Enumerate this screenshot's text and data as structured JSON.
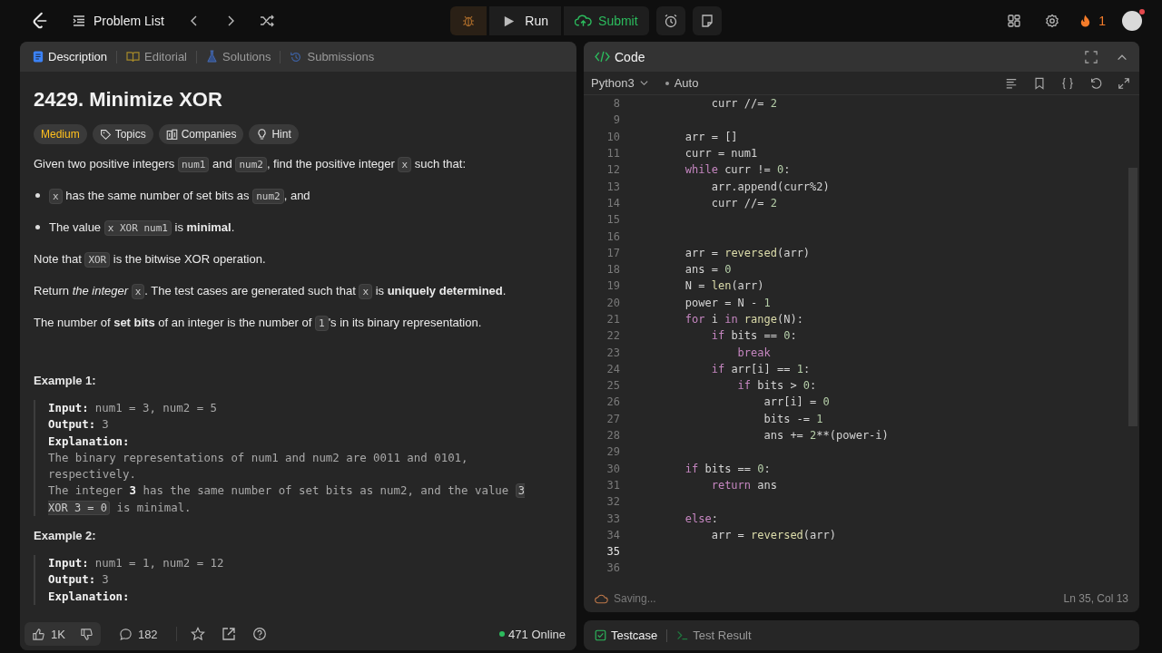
{
  "topbar": {
    "problem_list": "Problem List",
    "run": "Run",
    "submit": "Submit",
    "streak": "1"
  },
  "description_tabs": [
    {
      "label": "Description",
      "kind": "description",
      "selected": true
    },
    {
      "label": "Editorial",
      "kind": "editorial",
      "selected": false
    },
    {
      "label": "Solutions",
      "kind": "solutions",
      "selected": false
    },
    {
      "label": "Submissions",
      "kind": "submissions",
      "selected": false
    }
  ],
  "problem": {
    "title": "2429. Minimize XOR",
    "difficulty": "Medium",
    "tags": [
      {
        "label": "Topics",
        "kind": "topics"
      },
      {
        "label": "Companies",
        "kind": "companies"
      },
      {
        "label": "Hint",
        "kind": "hint"
      }
    ],
    "paragraphs": [
      {
        "kind": "para",
        "segments": [
          {
            "kind": "plain",
            "text": "Given two positive integers "
          },
          {
            "kind": "code",
            "text": "num1"
          },
          {
            "kind": "plain",
            "text": " and "
          },
          {
            "kind": "code",
            "text": "num2"
          },
          {
            "kind": "plain",
            "text": ", find the positive integer "
          },
          {
            "kind": "code",
            "text": "x"
          },
          {
            "kind": "plain",
            "text": " such that:"
          }
        ]
      },
      {
        "kind": "bullet",
        "segments": [
          {
            "kind": "code",
            "text": "x"
          },
          {
            "kind": "plain",
            "text": " has the same number of set bits as "
          },
          {
            "kind": "code",
            "text": "num2"
          },
          {
            "kind": "plain",
            "text": ", and"
          }
        ]
      },
      {
        "kind": "bullet",
        "segments": [
          {
            "kind": "plain",
            "text": "The value "
          },
          {
            "kind": "code",
            "text": "x XOR num1"
          },
          {
            "kind": "plain",
            "text": " is "
          },
          {
            "kind": "bold",
            "text": "minimal"
          },
          {
            "kind": "plain",
            "text": "."
          }
        ]
      },
      {
        "kind": "para",
        "segments": [
          {
            "kind": "plain",
            "text": "Note that "
          },
          {
            "kind": "code",
            "text": "XOR"
          },
          {
            "kind": "plain",
            "text": " is the bitwise XOR operation."
          }
        ]
      },
      {
        "kind": "para",
        "segments": [
          {
            "kind": "plain",
            "text": "Return "
          },
          {
            "kind": "italic",
            "text": "the integer "
          },
          {
            "kind": "code",
            "text": "x"
          },
          {
            "kind": "plain",
            "text": ". The test cases are generated such that "
          },
          {
            "kind": "code",
            "text": "x"
          },
          {
            "kind": "plain",
            "text": " is "
          },
          {
            "kind": "bold",
            "text": "uniquely determined"
          },
          {
            "kind": "plain",
            "text": "."
          }
        ]
      },
      {
        "kind": "para",
        "segments": [
          {
            "kind": "plain",
            "text": "The number of "
          },
          {
            "kind": "bold",
            "text": "set bits"
          },
          {
            "kind": "plain",
            "text": " of an integer is the number of "
          },
          {
            "kind": "code",
            "text": "1"
          },
          {
            "kind": "plain",
            "text": "'s in its binary representation."
          }
        ]
      }
    ],
    "examples": [
      {
        "title": "Example 1:",
        "lines": [
          {
            "label": "Input:",
            "value": "num1 = 3, num2 = 5"
          },
          {
            "label": "Output:",
            "value": "3"
          },
          {
            "label": "Explanation:"
          }
        ],
        "explanation": [
          [
            {
              "kind": "plain",
              "text": "The binary representations of num1 and num2 are 0011 and 0101, respectively."
            }
          ],
          [
            {
              "kind": "plain",
              "text": "The integer "
            },
            {
              "kind": "bold",
              "text": "3"
            },
            {
              "kind": "plain",
              "text": " has the same number of set bits as num2, and the value "
            },
            {
              "kind": "code",
              "text": "3 XOR 3 = 0"
            },
            {
              "kind": "plain",
              "text": " is minimal."
            }
          ]
        ]
      },
      {
        "title": "Example 2:",
        "lines": [
          {
            "label": "Input:",
            "value": "num1 = 1, num2 = 12"
          },
          {
            "label": "Output:",
            "value": "3"
          },
          {
            "label": "Explanation:"
          }
        ]
      }
    ]
  },
  "footer": {
    "likes": "1K",
    "comments": "182",
    "online": "471 Online"
  },
  "code_panel": {
    "title": "Code",
    "language": "Python3",
    "mode": "Auto",
    "status": "Saving...",
    "cursor": "Ln 35, Col 13",
    "lines": [
      {
        "n": "8",
        "current": false,
        "tokens": [
          {
            "kind": "plain",
            "text": "            curr //= "
          },
          {
            "kind": "num",
            "text": "2"
          }
        ]
      },
      {
        "n": "9",
        "current": false
      },
      {
        "n": "10",
        "current": false,
        "tokens": [
          {
            "kind": "plain",
            "text": "        arr = []"
          }
        ]
      },
      {
        "n": "11",
        "current": false,
        "tokens": [
          {
            "kind": "plain",
            "text": "        curr = num1"
          }
        ]
      },
      {
        "n": "12",
        "current": false,
        "tokens": [
          {
            "kind": "kw",
            "text": "        while"
          },
          {
            "kind": "plain",
            "text": " curr != "
          },
          {
            "kind": "num",
            "text": "0"
          },
          {
            "kind": "plain",
            "text": ":"
          }
        ]
      },
      {
        "n": "13",
        "current": false,
        "tokens": [
          {
            "kind": "plain",
            "text": "            arr.append(curr%2)"
          }
        ]
      },
      {
        "n": "14",
        "current": false,
        "tokens": [
          {
            "kind": "plain",
            "text": "            curr //= "
          },
          {
            "kind": "num",
            "text": "2"
          }
        ]
      },
      {
        "n": "15",
        "current": false
      },
      {
        "n": "16",
        "current": false
      },
      {
        "n": "17",
        "current": false,
        "tokens": [
          {
            "kind": "plain",
            "text": "        arr = "
          },
          {
            "kind": "fn",
            "text": "reversed"
          },
          {
            "kind": "plain",
            "text": "(arr)"
          }
        ]
      },
      {
        "n": "18",
        "current": false,
        "tokens": [
          {
            "kind": "plain",
            "text": "        ans = "
          },
          {
            "kind": "num",
            "text": "0"
          }
        ]
      },
      {
        "n": "19",
        "current": false,
        "tokens": [
          {
            "kind": "plain",
            "text": "        N = "
          },
          {
            "kind": "fn",
            "text": "len"
          },
          {
            "kind": "plain",
            "text": "(arr)"
          }
        ]
      },
      {
        "n": "20",
        "current": false,
        "tokens": [
          {
            "kind": "plain",
            "text": "        power = N - "
          },
          {
            "kind": "num",
            "text": "1"
          }
        ]
      },
      {
        "n": "21",
        "current": false,
        "tokens": [
          {
            "kind": "kw",
            "text": "        for"
          },
          {
            "kind": "plain",
            "text": " i "
          },
          {
            "kind": "kw",
            "text": "in"
          },
          {
            "kind": "fn",
            "text": " range"
          },
          {
            "kind": "plain",
            "text": "(N):"
          }
        ]
      },
      {
        "n": "22",
        "current": false,
        "tokens": [
          {
            "kind": "kw",
            "text": "            if"
          },
          {
            "kind": "plain",
            "text": " bits == "
          },
          {
            "kind": "num",
            "text": "0"
          },
          {
            "kind": "plain",
            "text": ":"
          }
        ]
      },
      {
        "n": "23",
        "current": false,
        "tokens": [
          {
            "kind": "kw",
            "text": "                break"
          }
        ]
      },
      {
        "n": "24",
        "current": false,
        "tokens": [
          {
            "kind": "kw",
            "text": "            if"
          },
          {
            "kind": "plain",
            "text": " arr[i] == "
          },
          {
            "kind": "num",
            "text": "1"
          },
          {
            "kind": "plain",
            "text": ":"
          }
        ]
      },
      {
        "n": "25",
        "current": false,
        "tokens": [
          {
            "kind": "kw",
            "text": "                if"
          },
          {
            "kind": "plain",
            "text": " bits > "
          },
          {
            "kind": "num",
            "text": "0"
          },
          {
            "kind": "plain",
            "text": ":"
          }
        ]
      },
      {
        "n": "26",
        "current": false,
        "tokens": [
          {
            "kind": "plain",
            "text": "                    arr[i] = "
          },
          {
            "kind": "num",
            "text": "0"
          }
        ]
      },
      {
        "n": "27",
        "current": false,
        "tokens": [
          {
            "kind": "plain",
            "text": "                    bits -= "
          },
          {
            "kind": "num",
            "text": "1"
          }
        ]
      },
      {
        "n": "28",
        "current": false,
        "tokens": [
          {
            "kind": "plain",
            "text": "                    ans += "
          },
          {
            "kind": "num",
            "text": "2"
          },
          {
            "kind": "plain",
            "text": "**(power-i)"
          }
        ]
      },
      {
        "n": "29",
        "current": false
      },
      {
        "n": "30",
        "current": false,
        "tokens": [
          {
            "kind": "kw",
            "text": "        if"
          },
          {
            "kind": "plain",
            "text": " bits == "
          },
          {
            "kind": "num",
            "text": "0"
          },
          {
            "kind": "plain",
            "text": ":"
          }
        ]
      },
      {
        "n": "31",
        "current": false,
        "tokens": [
          {
            "kind": "kw",
            "text": "            return"
          },
          {
            "kind": "plain",
            "text": " ans"
          }
        ]
      },
      {
        "n": "32",
        "current": false
      },
      {
        "n": "33",
        "current": false,
        "tokens": [
          {
            "kind": "kw",
            "text": "        else"
          },
          {
            "kind": "plain",
            "text": ":"
          }
        ]
      },
      {
        "n": "34",
        "current": false,
        "tokens": [
          {
            "kind": "plain",
            "text": "            arr = "
          },
          {
            "kind": "fn",
            "text": "reversed"
          },
          {
            "kind": "plain",
            "text": "(arr)"
          }
        ]
      },
      {
        "n": "35",
        "current": true
      },
      {
        "n": "36",
        "current": false
      }
    ]
  },
  "bottom_tabs": [
    {
      "label": "Testcase",
      "kind": "testcase",
      "selected": true
    },
    {
      "label": "Test Result",
      "kind": "result",
      "selected": false
    }
  ]
}
